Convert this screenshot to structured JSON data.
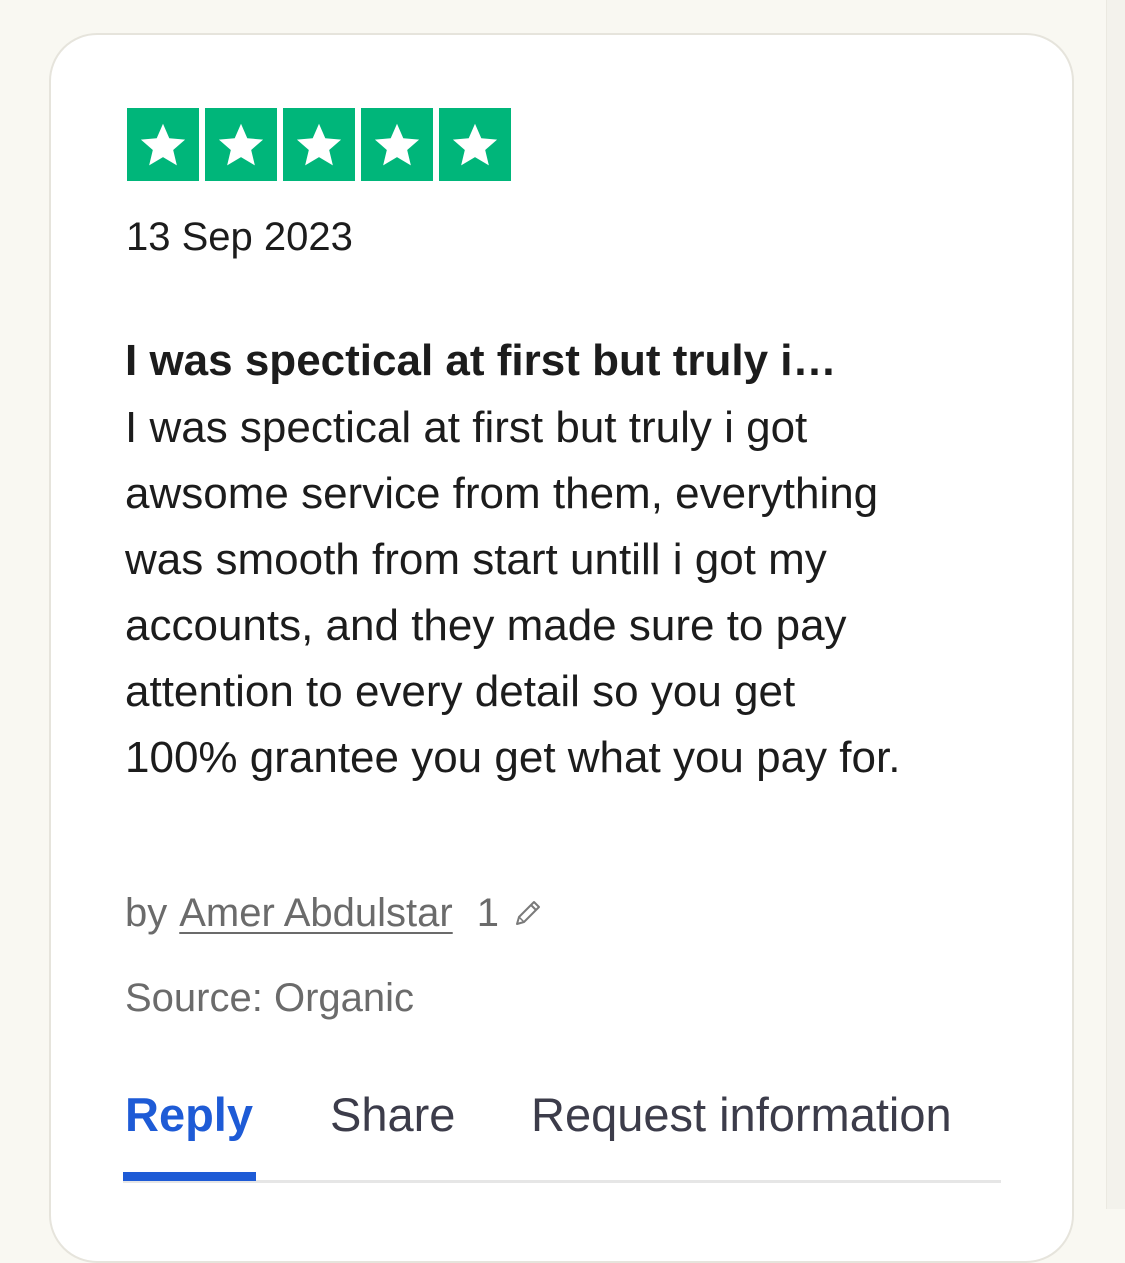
{
  "review": {
    "rating": 5,
    "rating_max": 5,
    "date": "13 Sep 2023",
    "title": "I was spectical at first but truly i…",
    "body_lines": [
      "I was spectical at first but truly i got",
      "awsome service from them, everything",
      "was smooth from start untill i got my",
      "accounts, and they made sure to pay",
      "attention to every detail so you get",
      "100% grantee you get what you pay for."
    ],
    "author_prefix": "by",
    "author_name": "Amer Abdulstar",
    "author_review_count": "1",
    "source": "Source: Organic"
  },
  "actions": {
    "reply_label": "Reply",
    "share_label": "Share",
    "request_label": "Request information",
    "active_tab": "reply"
  },
  "colors": {
    "star_green": "#00b67a",
    "accent_blue": "#1e5bd6",
    "background": "#f9f8f2",
    "card": "#ffffff"
  },
  "icons": {
    "star": "star-icon",
    "edit": "pencil-icon"
  }
}
